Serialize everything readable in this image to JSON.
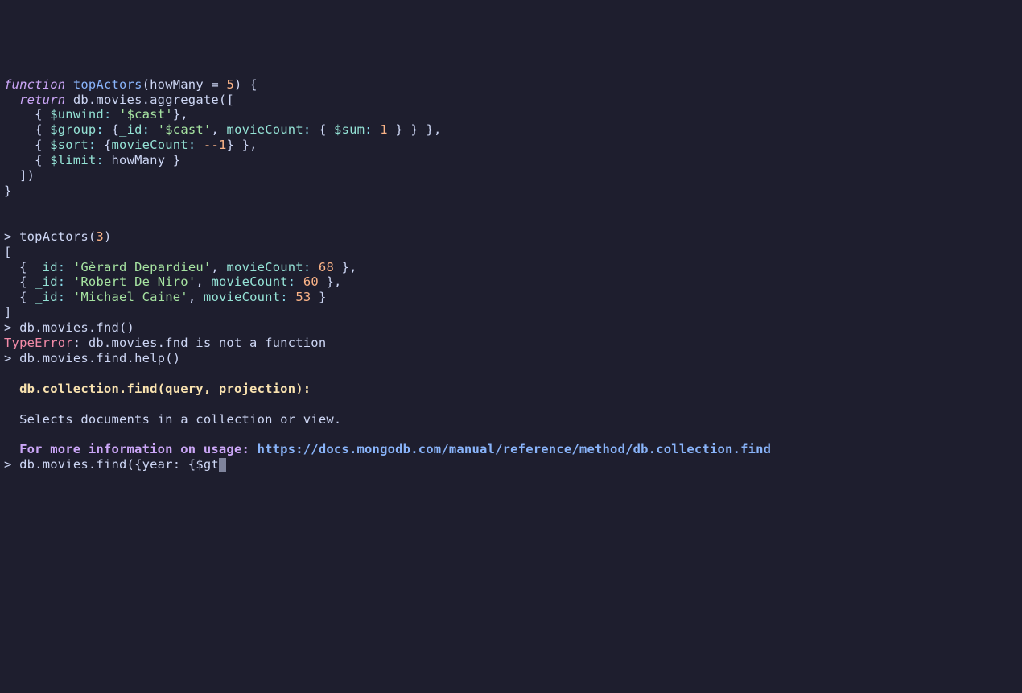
{
  "funcdef": {
    "kw": "function",
    "name": "topActors",
    "params_open": "(howMany = ",
    "default": "5",
    "params_close": ") {",
    "ret": "return",
    "agg": " db.movies.aggregate([",
    "unwind_op": "$unwind",
    "unwind_val": "'$cast'",
    "group_op": "$group",
    "group_id": "_id",
    "group_cast": "'$cast'",
    "group_mc": "movieCount",
    "sum_op": "$sum",
    "sum_val": "1",
    "sort_op": "$sort",
    "sort_key": "movieCount",
    "sort_dir": "-1",
    "limit_op": "$limit",
    "limit_val": "howMany",
    "close1": "  ])",
    "close2": "}"
  },
  "call1": {
    "prompt": ">",
    "fn": "topActors(",
    "arg": "3",
    "close": ")",
    "openbracket": "[",
    "r1_id": "_id",
    "r1_name": "'Gèrard Depardieu'",
    "r1_mc": "movieCount",
    "r1_val": "68",
    "r2_id": "_id",
    "r2_name": "'Robert De Niro'",
    "r2_mc": "movieCount",
    "r2_val": "60",
    "r3_id": "_id",
    "r3_name": "'Michael Caine'",
    "r3_mc": "movieCount",
    "r3_val": "53",
    "closebracket": "]"
  },
  "err": {
    "prompt": ">",
    "cmd": "db.movies.fnd()",
    "label": "TypeError",
    "msg": ": db.movies.fnd is not a function"
  },
  "help": {
    "prompt": ">",
    "cmd": "db.movies.find.help()",
    "sig": "db.collection.find(query, projection):",
    "desc": "Selects documents in a collection or view.",
    "more": "For more information on usage: ",
    "url": "https://docs.mongodb.com/manual/reference/method/db.collection.find"
  },
  "input": {
    "prompt": ">",
    "text": "db.movies.find({year: {$gt"
  }
}
